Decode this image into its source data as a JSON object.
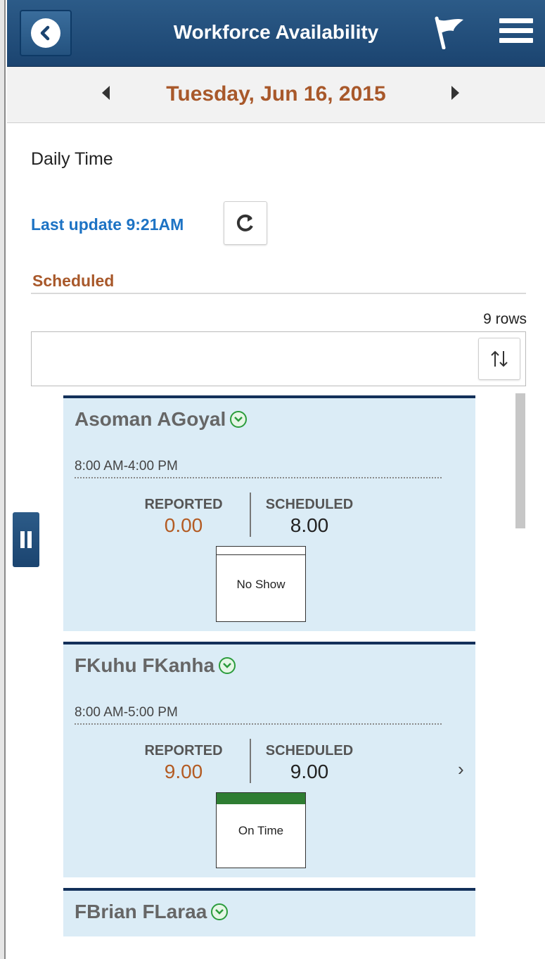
{
  "header": {
    "title": "Workforce Availability",
    "back_icon": "chevron-left-icon",
    "flag_icon": "flag-icon",
    "menu_icon": "hamburger-menu-icon"
  },
  "datebar": {
    "date": "Tuesday, Jun 16, 2015"
  },
  "section_title": "Daily Time",
  "last_update": "Last update 9:21AM",
  "group_label": "Scheduled",
  "row_count": "9 rows",
  "cards": [
    {
      "name": "Asoman AGoyal",
      "time": "8:00 AM-4:00 PM",
      "reported_label": "REPORTED",
      "reported_value": "0.00",
      "scheduled_label": "SCHEDULED",
      "scheduled_value": "8.00",
      "status": "No Show",
      "status_color": "#ffffff"
    },
    {
      "name": "FKuhu FKanha",
      "time": "8:00 AM-5:00 PM",
      "reported_label": "REPORTED",
      "reported_value": "9.00",
      "scheduled_label": "SCHEDULED",
      "scheduled_value": "9.00",
      "status": "On Time",
      "status_color": "#2e7d32"
    },
    {
      "name": "FBrian FLaraa"
    }
  ],
  "colors": {
    "header_bg": "#1b4470",
    "accent_orange": "#a8582a",
    "link_blue": "#1d73c4",
    "card_bg": "#dbecf6"
  }
}
